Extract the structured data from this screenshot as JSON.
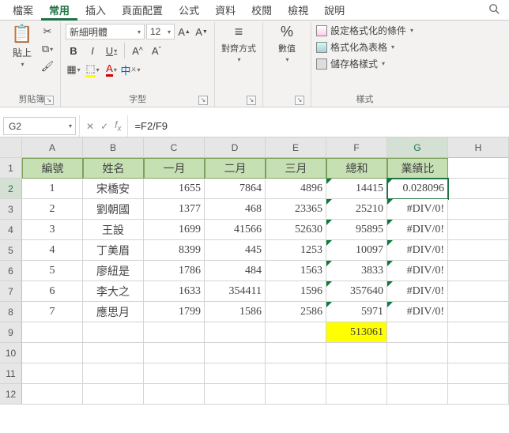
{
  "tabs": {
    "items": [
      "檔案",
      "常用",
      "插入",
      "頁面配置",
      "公式",
      "資料",
      "校閱",
      "檢視",
      "說明"
    ],
    "active_index": 1
  },
  "ribbon": {
    "clipboard": {
      "paste": "貼上",
      "group_label": "剪貼簿"
    },
    "font": {
      "name": "新細明體",
      "size": "12",
      "bold": "B",
      "italic": "I",
      "underline": "U",
      "group_label": "字型",
      "phonetic": "中"
    },
    "alignment": {
      "label": "對齊方式"
    },
    "number": {
      "label": "數值",
      "percent": "%"
    },
    "styles": {
      "cond_fmt": "設定格式化的條件",
      "as_table": "格式化為表格",
      "cell_styles": "儲存格樣式",
      "group_label": "樣式"
    }
  },
  "formula_bar": {
    "namebox": "G2",
    "formula": "=F2/F9"
  },
  "grid": {
    "col_headers": [
      "A",
      "B",
      "C",
      "D",
      "E",
      "F",
      "G",
      "H"
    ],
    "row_headers": [
      1,
      2,
      3,
      4,
      5,
      6,
      7,
      8,
      9,
      10,
      11,
      12
    ],
    "selected_col": "G",
    "selected_row": 2,
    "table_headers": [
      "編號",
      "姓名",
      "一月",
      "二月",
      "三月",
      "總和",
      "業績比"
    ],
    "rows": [
      {
        "id": "1",
        "name": "宋橋安",
        "m1": 1655,
        "m2": 7864,
        "m3": 4896,
        "sum": 14415,
        "ratio": "0.028096"
      },
      {
        "id": "2",
        "name": "劉朝國",
        "m1": 1377,
        "m2": 468,
        "m3": 23365,
        "sum": 25210,
        "ratio": "#DIV/0!"
      },
      {
        "id": "3",
        "name": "王設",
        "m1": 1699,
        "m2": 41566,
        "m3": 52630,
        "sum": 95895,
        "ratio": "#DIV/0!"
      },
      {
        "id": "4",
        "name": "丁美眉",
        "m1": 8399,
        "m2": 445,
        "m3": 1253,
        "sum": 10097,
        "ratio": "#DIV/0!"
      },
      {
        "id": "5",
        "name": "廖紐是",
        "m1": 1786,
        "m2": 484,
        "m3": 1563,
        "sum": 3833,
        "ratio": "#DIV/0!"
      },
      {
        "id": "6",
        "name": "李大之",
        "m1": 1633,
        "m2": 354411,
        "m3": 1596,
        "sum": 357640,
        "ratio": "#DIV/0!"
      },
      {
        "id": "7",
        "name": "應思月",
        "m1": 1799,
        "m2": 1586,
        "m3": 2586,
        "sum": 5971,
        "ratio": "#DIV/0!"
      }
    ],
    "grand_total": 513061
  }
}
